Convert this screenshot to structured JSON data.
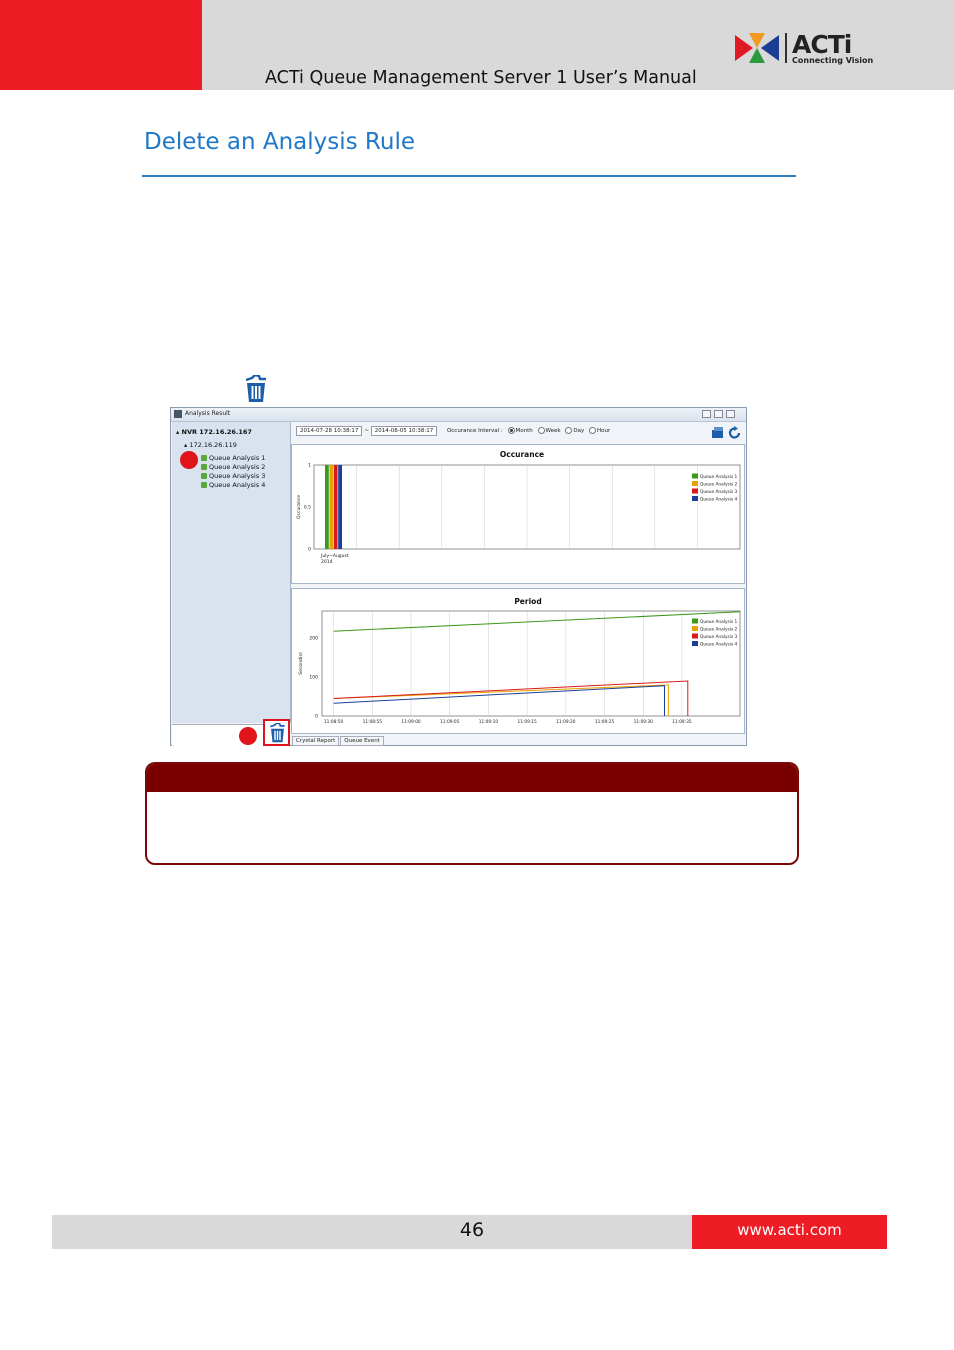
{
  "header": {
    "manual_title": "ACTi Queue Management Server 1 User’s Manual",
    "logo_word": "ACTi",
    "logo_tagline": "Connecting Vision",
    "brand_red": "#ee1c25"
  },
  "section": {
    "title": "Delete an Analysis Rule",
    "title_color": "#1f77c8"
  },
  "screenshot": {
    "window_title": "Analysis Result",
    "tree": {
      "nvr": "NVR 172.16.26.167",
      "camera": "172.16.26.119",
      "rules": [
        "Queue Analysis 1",
        "Queue Analysis 2",
        "Queue Analysis 3",
        "Queue Analysis 4"
      ]
    },
    "toolbar": {
      "from_date": "2014-07-28 10:38:17",
      "to_date": "2014-08-05 10:38:17",
      "range_sep": "~",
      "interval_label": "Occurance Interval :",
      "intervals": [
        "Month",
        "Week",
        "Day",
        "Hour"
      ],
      "selected_interval": "Month"
    },
    "tabs": [
      "Crystal Report",
      "Queue Event"
    ],
    "icons": [
      "trash-icon",
      "export-icon",
      "refresh-icon"
    ]
  },
  "chart_data": [
    {
      "type": "bar",
      "title": "Occurance",
      "ylabel": "Occurance",
      "xlabel": "",
      "categories": [
        "July~August 2014"
      ],
      "category_lines": [
        "July~August",
        "2014"
      ],
      "ylim": [
        0,
        1
      ],
      "yticks": [
        "0",
        "0.5",
        "1"
      ],
      "series": [
        {
          "name": "Queue Analysis 1",
          "color": "#3c9a1a",
          "values": [
            1
          ]
        },
        {
          "name": "Queue Analysis 2",
          "color": "#e8a200",
          "values": [
            1
          ]
        },
        {
          "name": "Queue Analysis 3",
          "color": "#d91a1a",
          "values": [
            1
          ]
        },
        {
          "name": "Queue Analysis 4",
          "color": "#1d3f9a",
          "values": [
            1
          ]
        }
      ],
      "legend": "top-right",
      "grid": true
    },
    {
      "type": "line",
      "title": "Period",
      "ylabel": "Second(s)",
      "xlabel": "",
      "x": [
        "11:08:50",
        "11:08:55",
        "11:09:00",
        "11:09:05",
        "11:09:10",
        "11:09:15",
        "11:09:20",
        "11:09:25",
        "11:09:30",
        "11:09:35"
      ],
      "ylim": [
        0,
        270
      ],
      "yticks": [
        "0",
        "100",
        "200"
      ],
      "series": [
        {
          "name": "Queue Analysis 1",
          "color": "#3c9a1a",
          "points": [
            [
              0,
              218
            ],
            [
              10.5,
              268
            ]
          ]
        },
        {
          "name": "Queue Analysis 2",
          "color": "#e8a200",
          "points": [
            [
              0,
              45
            ],
            [
              8.65,
              80
            ],
            [
              8.65,
              0
            ]
          ]
        },
        {
          "name": "Queue Analysis 3",
          "color": "#d91a1a",
          "points": [
            [
              0,
              45
            ],
            [
              9.15,
              90
            ],
            [
              9.15,
              0
            ]
          ]
        },
        {
          "name": "Queue Analysis 4",
          "color": "#1d3f9a",
          "points": [
            [
              0,
              33
            ],
            [
              8.55,
              78
            ],
            [
              8.55,
              0
            ]
          ]
        }
      ],
      "legend": "top-right",
      "grid": true
    }
  ],
  "footer": {
    "page_number": "46",
    "website": "www.acti.com"
  }
}
